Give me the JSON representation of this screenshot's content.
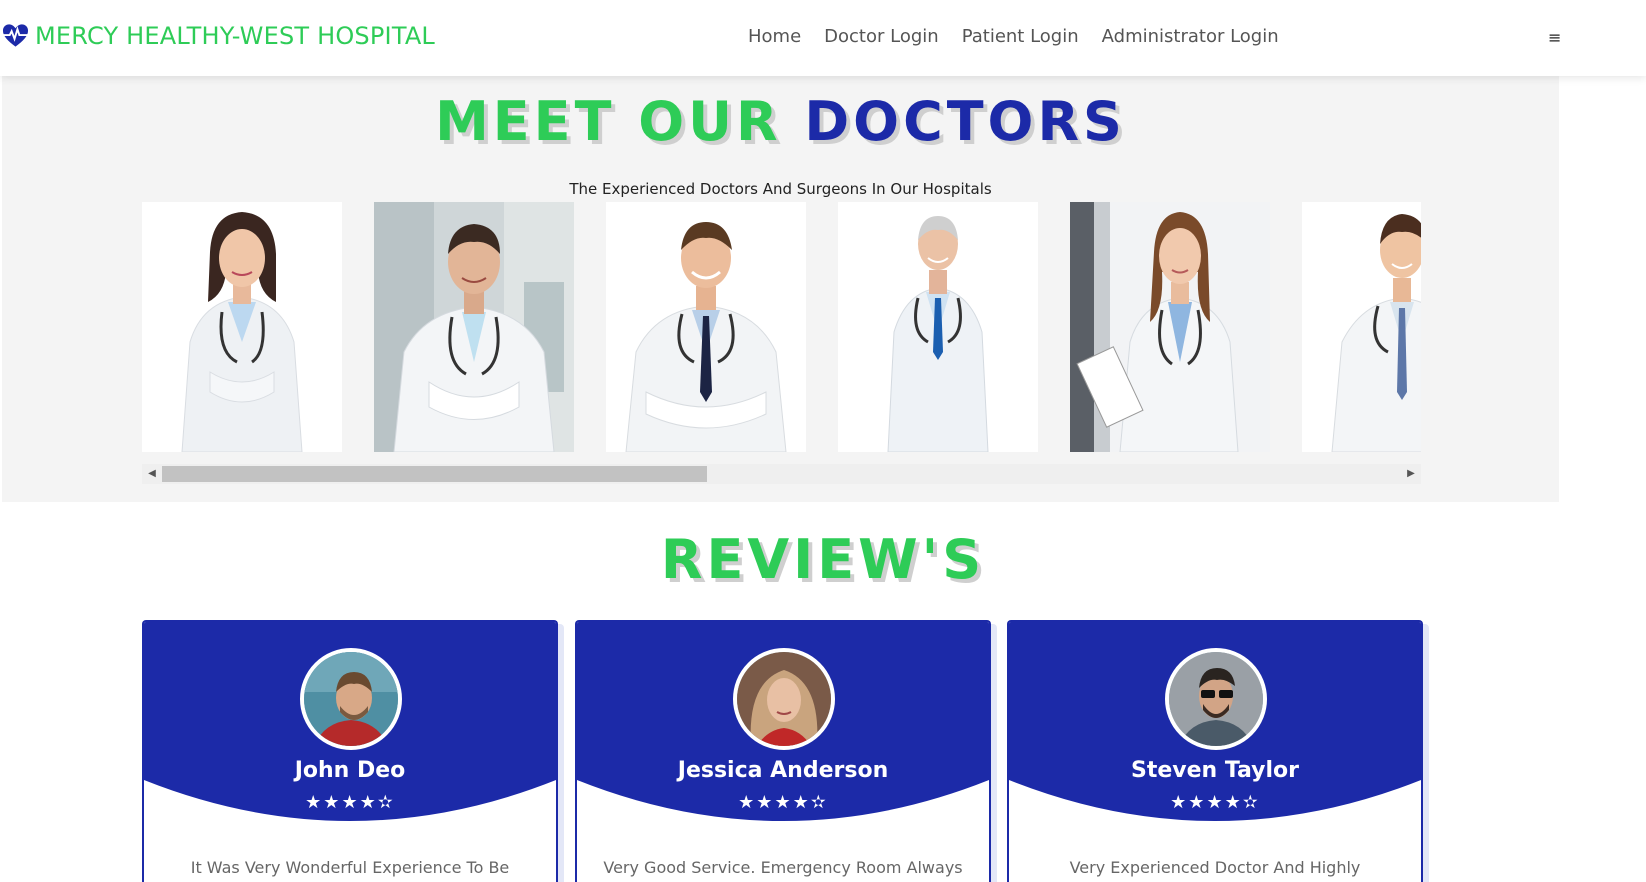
{
  "header": {
    "brand": "MERCY HEALTHY-WEST HOSPITAL",
    "brand_color": "#2ecc57",
    "nav": [
      "Home",
      "Doctor Login",
      "Patient Login",
      "Administrator Login"
    ],
    "menu_icon": "≡"
  },
  "doctors": {
    "title_part1": "MEET OUR",
    "title_part2": "DOCTORS",
    "subtitle": "The Experienced Doctors And Surgeons In Our Hospitals",
    "title_colors": {
      "green": "#2ecc57",
      "blue": "#1c2aa8"
    },
    "scroll": {
      "left_arrow": "◀",
      "right_arrow": "▶",
      "thumb_fraction": 0.44
    }
  },
  "reviews": {
    "title": "REVIEW'S",
    "card_color": "#1c2aa8",
    "items": [
      {
        "name": "John Deo",
        "stars": "★★★★✫",
        "text": "It Was Very Wonderful Experience To Be"
      },
      {
        "name": "Jessica Anderson",
        "stars": "★★★★✫",
        "text": "Very Good Service. Emergency Room Always"
      },
      {
        "name": "Steven Taylor",
        "stars": "★★★★✫",
        "text": "Very Experienced Doctor And Highly"
      }
    ]
  }
}
